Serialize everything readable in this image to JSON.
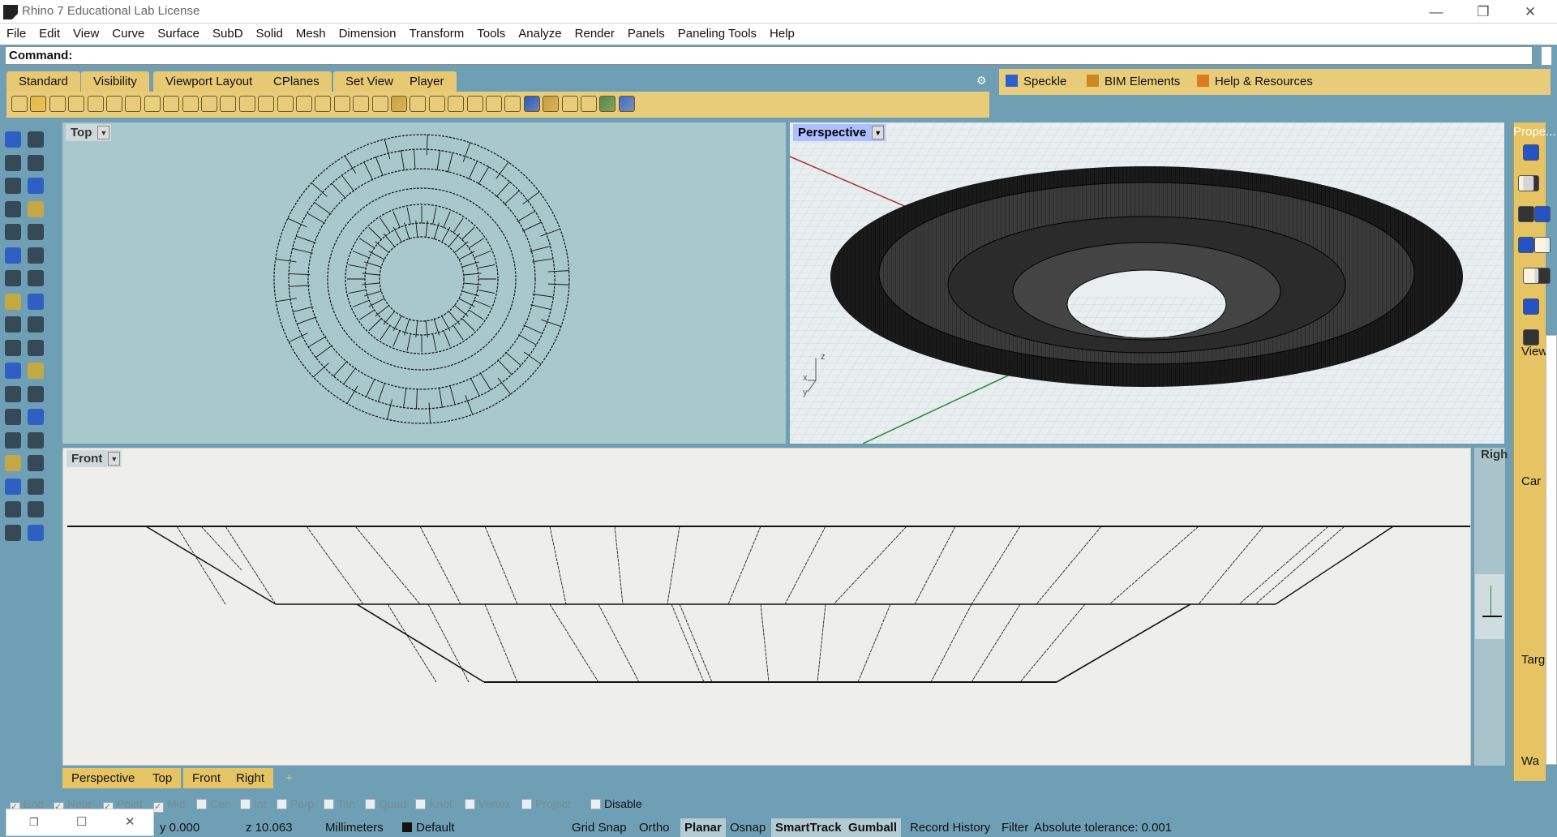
{
  "window": {
    "title": "Rhino 7 Educational Lab License"
  },
  "menu": [
    "File",
    "Edit",
    "View",
    "Curve",
    "Surface",
    "SubD",
    "Solid",
    "Mesh",
    "Dimension",
    "Transform",
    "Tools",
    "Analyze",
    "Render",
    "Panels",
    "Paneling Tools",
    "Help"
  ],
  "command": {
    "label": "Command:"
  },
  "toolbar_tabs": [
    "Standard",
    "Visibility",
    "Viewport Layout",
    "CPlanes",
    "Set View",
    "Player"
  ],
  "plugins": [
    {
      "label": "Speckle",
      "icon": "speckle-icon"
    },
    {
      "label": "BIM Elements",
      "icon": "bim-icon"
    },
    {
      "label": "Help & Resources",
      "icon": "help-resources-icon"
    }
  ],
  "viewports": {
    "top": {
      "label": "Top"
    },
    "perspective": {
      "label": "Perspective"
    },
    "front": {
      "label": "Front"
    },
    "right": {
      "label": "Righ"
    }
  },
  "properties_panel": {
    "title": "Prope...",
    "labels": [
      "View",
      "Car",
      "Targ",
      "Wa"
    ]
  },
  "viewport_tabs": [
    "Perspective",
    "Top",
    "Front",
    "Right"
  ],
  "osnaps": [
    {
      "label": "End",
      "checked": true
    },
    {
      "label": "Near",
      "checked": true
    },
    {
      "label": "Point",
      "checked": true
    },
    {
      "label": "Mid",
      "checked": true
    },
    {
      "label": "Cen",
      "checked": false
    },
    {
      "label": "Int",
      "checked": false
    },
    {
      "label": "Perp",
      "checked": false
    },
    {
      "label": "Tan",
      "checked": false
    },
    {
      "label": "Quad",
      "checked": false
    },
    {
      "label": "Knot",
      "checked": false
    },
    {
      "label": "Vertex",
      "checked": false
    },
    {
      "label": "Project",
      "checked": false
    },
    {
      "label": "Disable",
      "checked": false
    }
  ],
  "status": {
    "y": "y 0.000",
    "z": "z 10.063",
    "units": "Millimeters",
    "layer": "Default",
    "toggles": [
      "Grid Snap",
      "Ortho",
      "Planar",
      "Osnap",
      "SmartTrack",
      "Gumball",
      "Record History",
      "Filter"
    ],
    "toggles_active": [
      "Planar",
      "SmartTrack",
      "Gumball"
    ],
    "tolerance": "Absolute tolerance: 0.001"
  }
}
